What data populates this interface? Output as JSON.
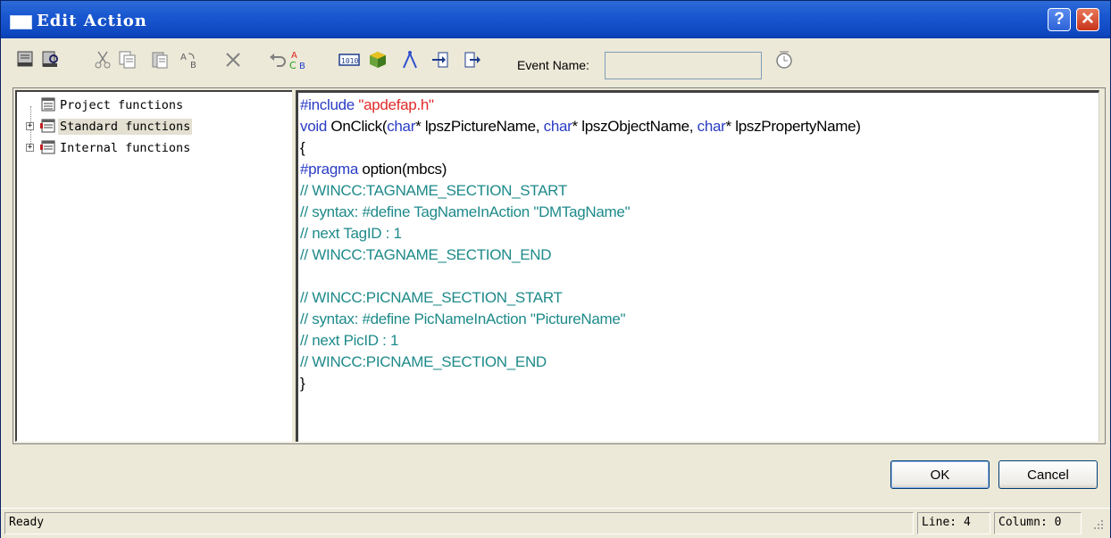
{
  "window": {
    "title": "Edit Action",
    "help_glyph": "?",
    "close_glyph": "✕"
  },
  "toolbar": {
    "event_name_label": "Event Name:",
    "event_name_value": "",
    "icons": [
      "new-icon",
      "print-preview-icon",
      "cut-icon",
      "copy-icon",
      "paste-icon",
      "replace-icon",
      "delete-icon",
      "undo-icon",
      "font-color-icon",
      "tag-icon",
      "cube-icon",
      "compass-icon",
      "import-icon",
      "export-icon",
      "clock-icon"
    ]
  },
  "tree": {
    "items": [
      {
        "label": "Project functions",
        "expandable": false
      },
      {
        "label": "Standard functions",
        "expandable": true
      },
      {
        "label": "Internal functions",
        "expandable": true
      }
    ]
  },
  "code": {
    "lines": [
      [
        {
          "t": "#include ",
          "c": "kw"
        },
        {
          "t": "\"apdefap.h\"",
          "c": "str"
        }
      ],
      [
        {
          "t": "void ",
          "c": "kw"
        },
        {
          "t": "OnClick(",
          "c": "pl"
        },
        {
          "t": "char",
          "c": "kw"
        },
        {
          "t": "* lpszPictureName, ",
          "c": "pl"
        },
        {
          "t": "char",
          "c": "kw"
        },
        {
          "t": "* lpszObjectName, ",
          "c": "pl"
        },
        {
          "t": "char",
          "c": "kw"
        },
        {
          "t": "* lpszPropertyName)",
          "c": "pl"
        }
      ],
      [
        {
          "t": "{",
          "c": "pl"
        }
      ],
      [
        {
          "t": "#pragma ",
          "c": "kw"
        },
        {
          "t": "option(mbcs)",
          "c": "pl"
        }
      ],
      [
        {
          "t": "// WINCC:TAGNAME_SECTION_START",
          "c": "cmt"
        }
      ],
      [
        {
          "t": "// syntax: #define TagNameInAction \"DMTagName\"",
          "c": "cmt"
        }
      ],
      [
        {
          "t": "// next TagID : 1",
          "c": "cmt"
        }
      ],
      [
        {
          "t": "// WINCC:TAGNAME_SECTION_END",
          "c": "cmt"
        }
      ],
      [
        {
          "t": "",
          "c": "pl"
        }
      ],
      [
        {
          "t": "// WINCC:PICNAME_SECTION_START",
          "c": "cmt"
        }
      ],
      [
        {
          "t": "// syntax: #define PicNameInAction \"PictureName\"",
          "c": "cmt"
        }
      ],
      [
        {
          "t": "// next PicID : 1",
          "c": "cmt"
        }
      ],
      [
        {
          "t": "// WINCC:PICNAME_SECTION_END",
          "c": "cmt"
        }
      ],
      [
        {
          "t": "}",
          "c": "pl"
        }
      ]
    ]
  },
  "buttons": {
    "ok": "OK",
    "cancel": "Cancel"
  },
  "status": {
    "text": "Ready",
    "line": "Line: 4",
    "column": "Column: 0"
  },
  "colors": {
    "keyword": "#2a3cc4",
    "string": "#e22a2a",
    "comment": "#1e8a8a",
    "titlebar": "#0f49c2"
  }
}
